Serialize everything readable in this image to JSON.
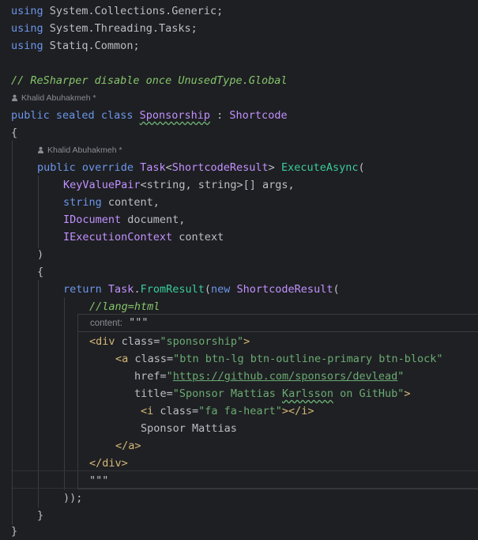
{
  "usings": [
    {
      "kw": "using",
      "ns": "System.Collections.Generic",
      "semi": ";"
    },
    {
      "kw": "using",
      "ns": "System.Threading.Tasks",
      "semi": ";"
    },
    {
      "kw": "using",
      "ns": "Statiq.Common",
      "semi": ";"
    }
  ],
  "comment": "// ReSharper disable once UnusedType.Global",
  "author_hint_1": "Khalid Abuhakmeh *",
  "class_line": {
    "public": "public",
    "sealed": "sealed",
    "class": "class",
    "name": "Sponsorship",
    "colon": " : ",
    "base": "Shortcode"
  },
  "open_brace": "{",
  "author_hint_2": "Khalid Abuhakmeh *",
  "method_line": {
    "public": "public",
    "override": "override",
    "task": "Task",
    "lt": "<",
    "result": "ShortcodeResult",
    "gt": ">",
    "name": "ExecuteAsync",
    "paren": "("
  },
  "params": [
    {
      "type": "KeyValuePair",
      "rest": "<string, string>[] args,"
    },
    {
      "type": "string",
      "rest": " content,"
    },
    {
      "type": "IDocument",
      "rest": " document,"
    },
    {
      "type": "IExecutionContext",
      "rest": " context"
    }
  ],
  "close_paren": ")",
  "inner_open": "{",
  "return_line": {
    "ret": "return",
    "task": "Task",
    "dot": ".",
    "fn": "FromResult",
    "p": "(",
    "new": "new",
    "cls": "ShortcodeResult",
    "p2": "("
  },
  "lang_comment": "//lang=html",
  "content_label": "content:",
  "triple_quote": "\"\"\"",
  "html_lines": {
    "div_open": {
      "lt": "<div",
      "attr": " class=",
      "val": "\"sponsorship\"",
      "gt": ">"
    },
    "a_open": {
      "lt": "<a",
      "attr": " class=",
      "val": "\"btn btn-lg btn-outline-primary btn-block\""
    },
    "href": {
      "attr": "href=",
      "q1": "\"",
      "url": "https://github.com/sponsors/devlead",
      "q2": "\""
    },
    "title": {
      "attr": "title=",
      "val1": "\"Sponsor Mattias ",
      "val2": "Karlsson",
      "val3": " on GitHub\"",
      "gt": ">"
    },
    "i_tag": {
      "lt": "<i",
      "attr": " class=",
      "val": "\"fa fa-heart\"",
      "close": "></i>"
    },
    "text": "Sponsor Mattias",
    "a_close": "</a>",
    "div_close": "</div>"
  },
  "close_triple": "\"\"\"",
  "close_call": "));",
  "inner_close": "}",
  "outer_close": "}"
}
